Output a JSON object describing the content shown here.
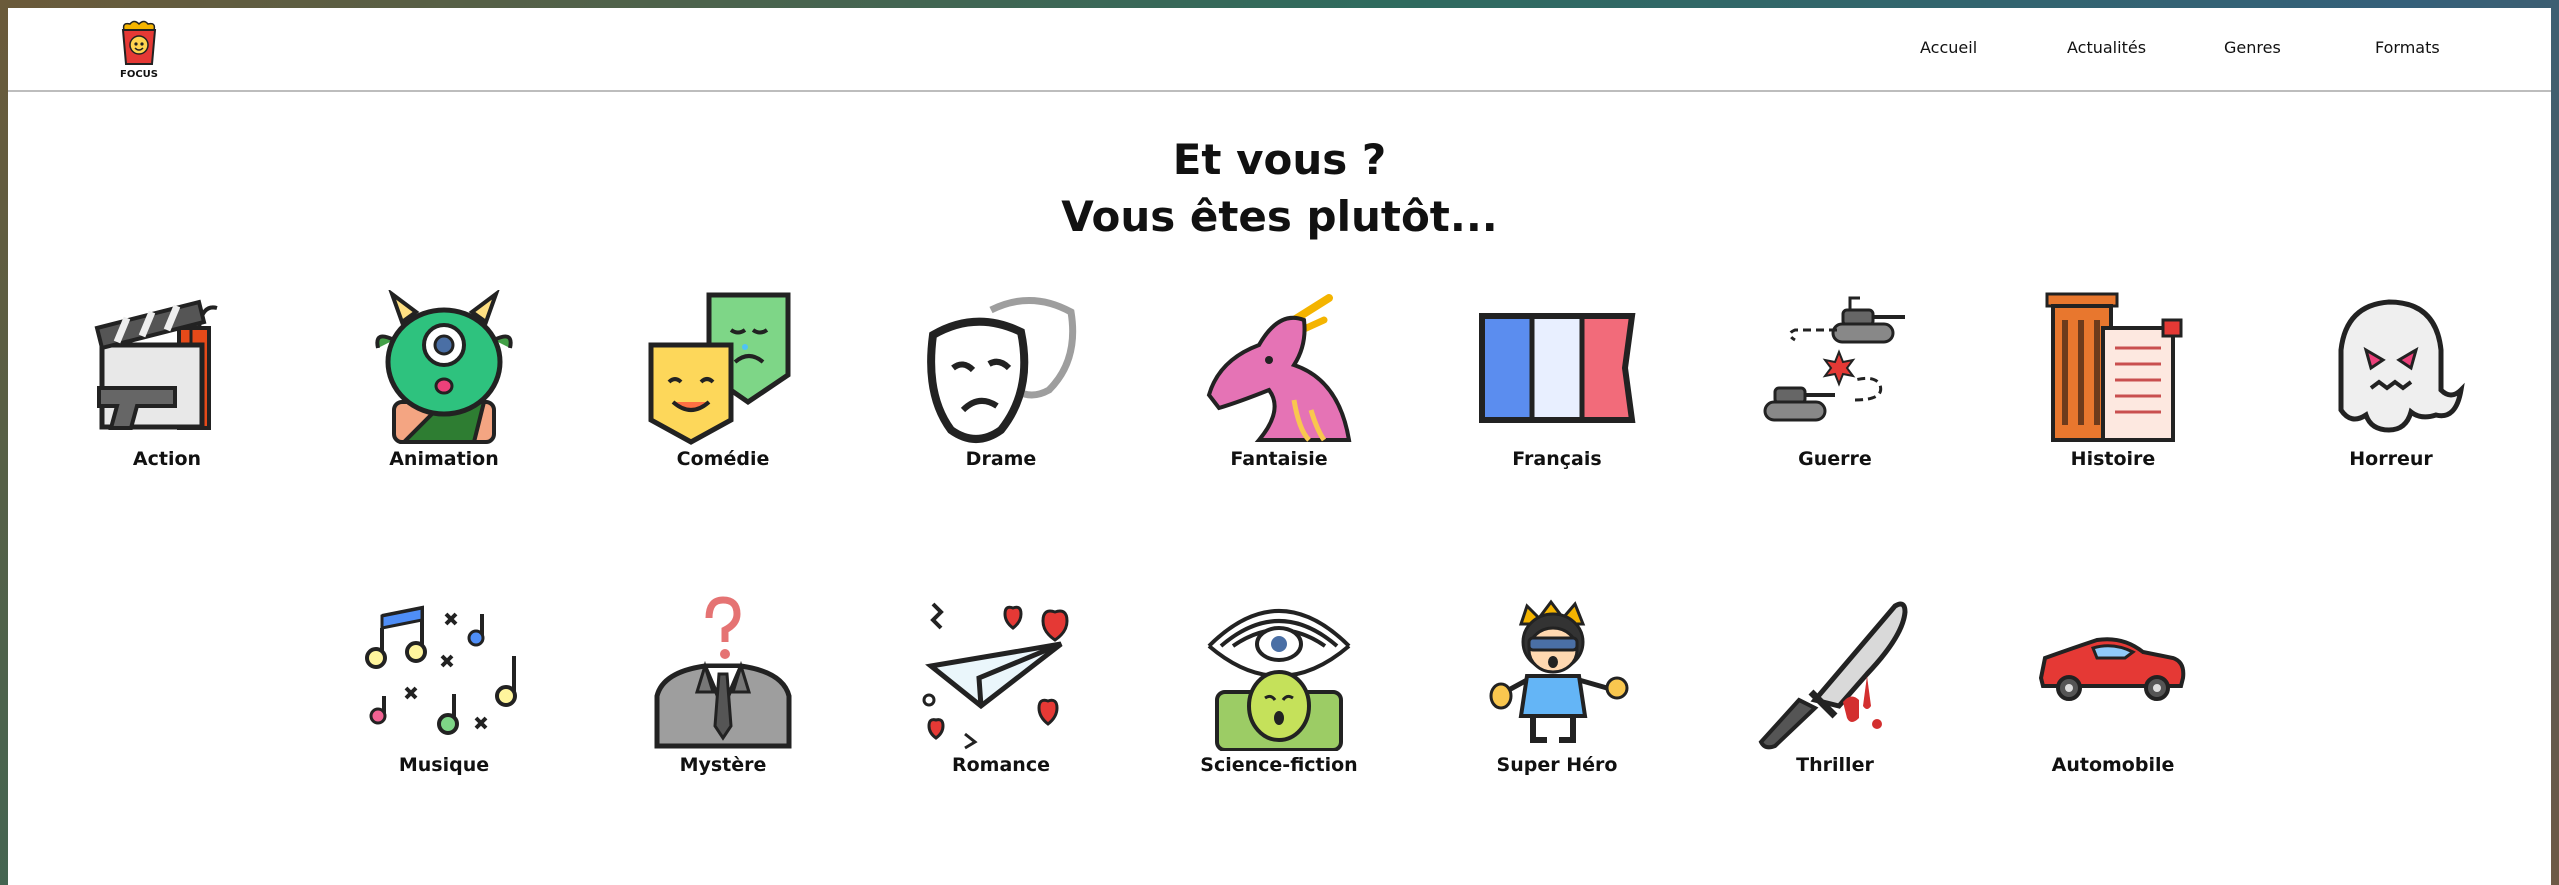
{
  "logo": {
    "text": "FOCUS"
  },
  "nav": {
    "items": [
      {
        "label": "Accueil"
      },
      {
        "label": "Actualités"
      },
      {
        "label": "Genres"
      },
      {
        "label": "Formats"
      }
    ]
  },
  "heading": {
    "line1": "Et vous ?",
    "line2": "Vous êtes plutôt..."
  },
  "genres_row1": [
    {
      "label": "Action",
      "icon": "clapperboard-gun-icon"
    },
    {
      "label": "Animation",
      "icon": "cyclops-monster-icon"
    },
    {
      "label": "Comédie",
      "icon": "theater-masks-icon"
    },
    {
      "label": "Drame",
      "icon": "sad-mask-icon"
    },
    {
      "label": "Fantaisie",
      "icon": "dragon-icon"
    },
    {
      "label": "Français",
      "icon": "french-flag-icon"
    },
    {
      "label": "Guerre",
      "icon": "tanks-icon"
    },
    {
      "label": "Histoire",
      "icon": "column-scroll-icon"
    },
    {
      "label": "Horreur",
      "icon": "ghost-icon"
    }
  ],
  "genres_row2": [
    {
      "label": "Musique",
      "icon": "music-notes-icon"
    },
    {
      "label": "Mystère",
      "icon": "question-suit-icon"
    },
    {
      "label": "Romance",
      "icon": "paper-plane-hearts-icon"
    },
    {
      "label": "Science-fiction",
      "icon": "alien-eye-icon"
    },
    {
      "label": "Super Héro",
      "icon": "superhero-icon"
    },
    {
      "label": "Thriller",
      "icon": "bloody-knife-icon"
    },
    {
      "label": "Automobile",
      "icon": "sports-car-icon"
    }
  ]
}
